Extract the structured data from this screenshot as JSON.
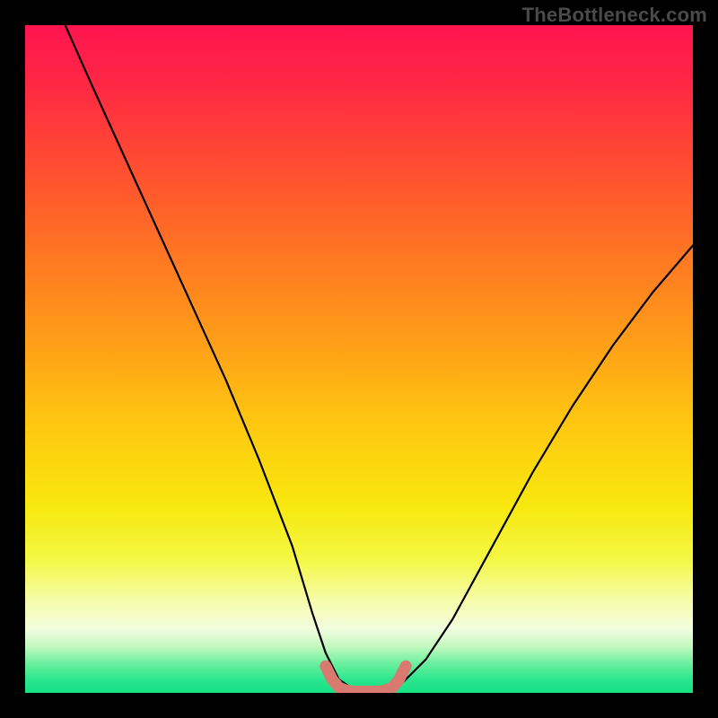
{
  "watermark": {
    "text": "TheBottleneck.com"
  },
  "gradient": {
    "stops": [
      {
        "offset": 0.0,
        "color": "#ff1450"
      },
      {
        "offset": 0.1,
        "color": "#ff2b42"
      },
      {
        "offset": 0.22,
        "color": "#ff5030"
      },
      {
        "offset": 0.35,
        "color": "#ff7822"
      },
      {
        "offset": 0.48,
        "color": "#ffa018"
      },
      {
        "offset": 0.6,
        "color": "#ffc810"
      },
      {
        "offset": 0.72,
        "color": "#f8e80e"
      },
      {
        "offset": 0.8,
        "color": "#f4f844"
      },
      {
        "offset": 0.86,
        "color": "#f6fca8"
      },
      {
        "offset": 0.905,
        "color": "#f2fde0"
      },
      {
        "offset": 0.93,
        "color": "#c4f9c0"
      },
      {
        "offset": 0.955,
        "color": "#6ef0a0"
      },
      {
        "offset": 0.98,
        "color": "#2be68e"
      },
      {
        "offset": 1.0,
        "color": "#18e084"
      }
    ]
  },
  "chart_data": {
    "type": "line",
    "title": "",
    "xlabel": "",
    "ylabel": "",
    "xlim": [
      0,
      100
    ],
    "ylim": [
      0,
      100
    ],
    "series": [
      {
        "name": "bottleneck-curve",
        "color": "#000000",
        "x": [
          6,
          10,
          15,
          20,
          25,
          30,
          35,
          40,
          43,
          45,
          47,
          50,
          53,
          55,
          57,
          60,
          64,
          70,
          76,
          82,
          88,
          94,
          100
        ],
        "values": [
          100,
          91,
          80,
          69,
          58,
          47,
          35,
          22,
          12,
          6,
          2,
          0,
          0,
          0,
          2,
          5,
          11,
          22,
          33,
          43,
          52,
          60,
          67
        ]
      },
      {
        "name": "flat-marker-band",
        "color": "#d87a70",
        "x": [
          45,
          46,
          47,
          48,
          49,
          50,
          51,
          52,
          53,
          54,
          55,
          56,
          57
        ],
        "values": [
          4,
          2,
          0.8,
          0.4,
          0.2,
          0.2,
          0.2,
          0.2,
          0.2,
          0.4,
          0.8,
          2,
          4
        ]
      }
    ],
    "annotations": []
  }
}
